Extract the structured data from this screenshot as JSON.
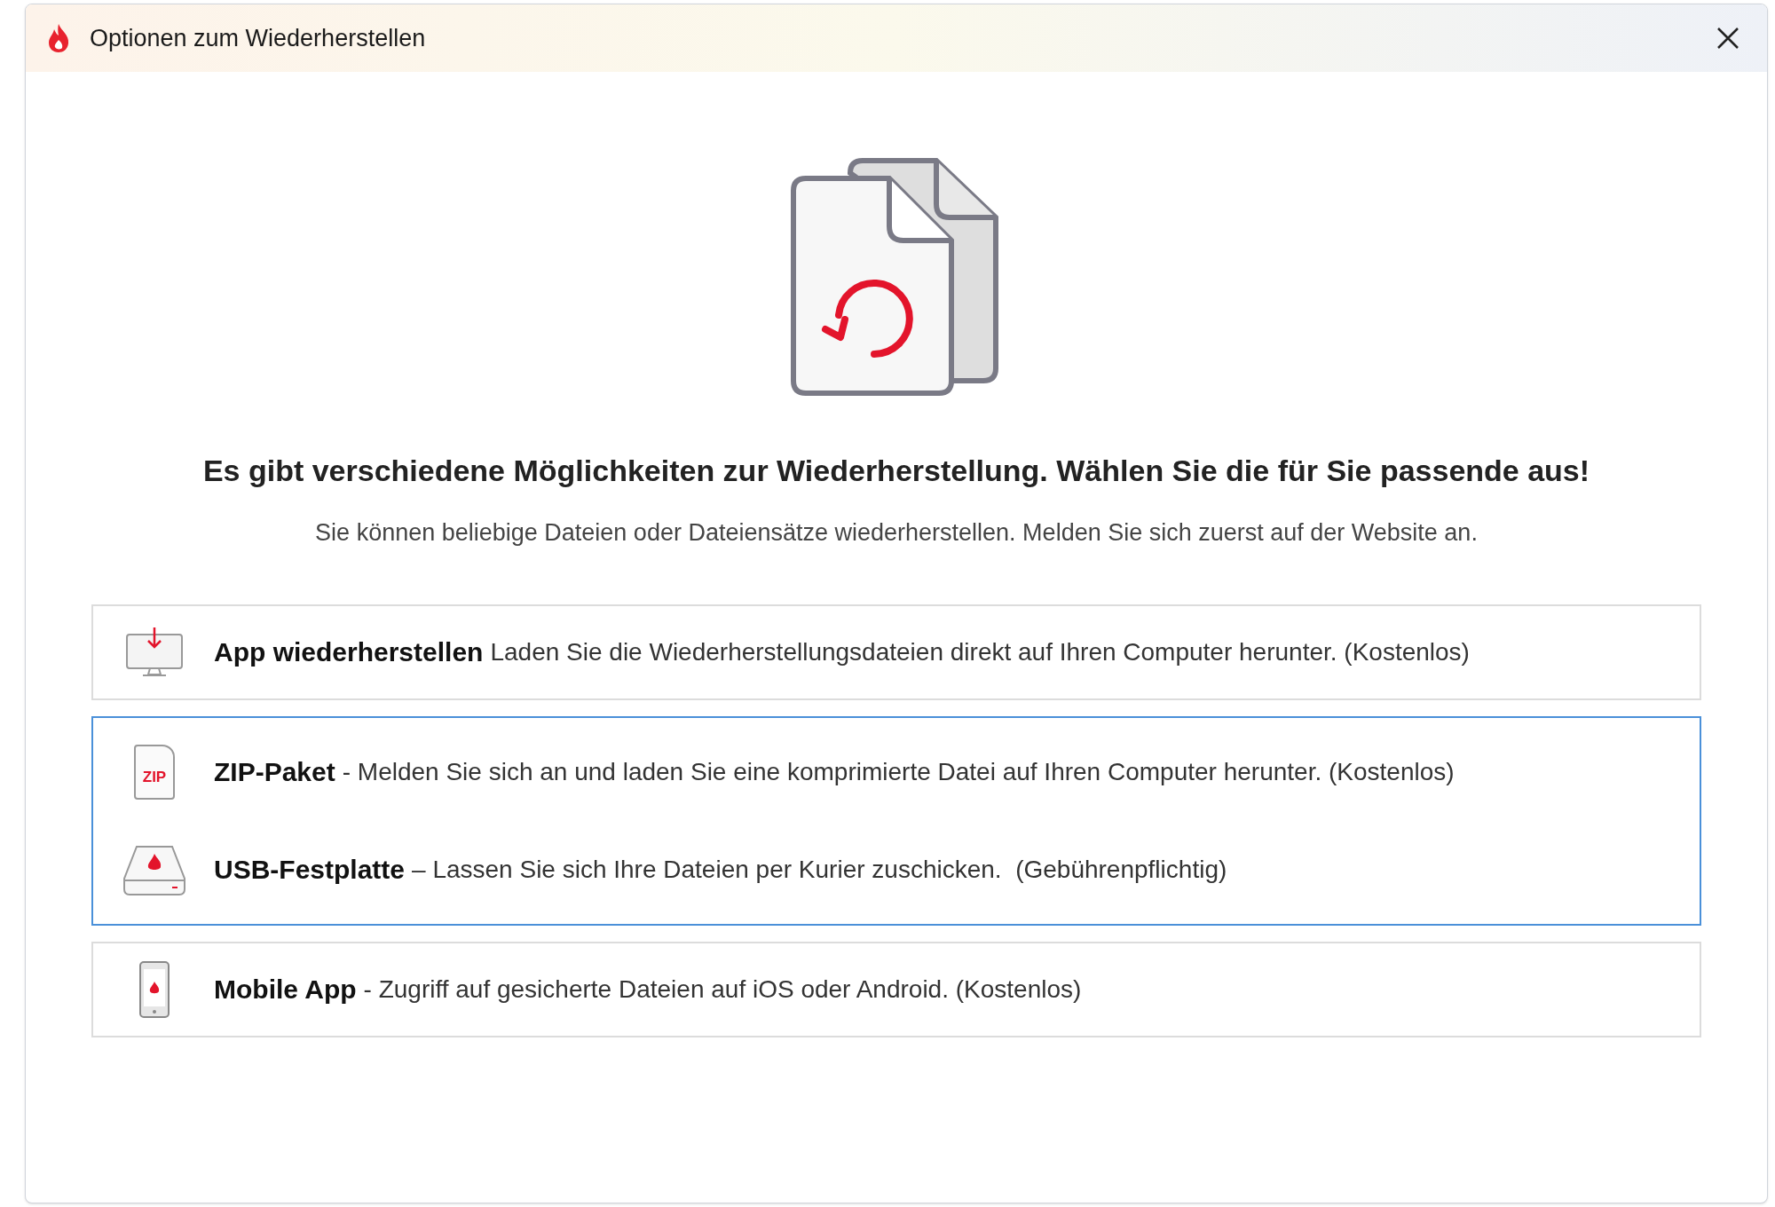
{
  "window": {
    "title": "Optionen zum Wiederherstellen"
  },
  "heading": "Es gibt verschiedene Möglichkeiten zur Wiederherstellung. Wählen Sie die für Sie passende aus!",
  "subtitle": "Sie können beliebige Dateien oder Dateiensätze wiederherstellen. Melden Sie sich zuerst auf der Website an.",
  "option_groups": [
    {
      "selected": false,
      "options": [
        {
          "kind": "monitor",
          "title": "App wiederherstellen",
          "description": "Laden Sie die Wiederherstellungsdateien direkt auf Ihren Computer herunter. (Kostenlos)"
        }
      ]
    },
    {
      "selected": true,
      "options": [
        {
          "kind": "zip",
          "icon_text": "ZIP",
          "title": "ZIP-Paket",
          "description": "- Melden Sie sich an und laden Sie eine komprimierte Datei auf Ihren Computer herunter. (Kostenlos)"
        },
        {
          "kind": "drive",
          "title": "USB-Festplatte",
          "description": "– Lassen Sie sich Ihre Dateien per Kurier zuschicken.  (Gebührenpflichtig)"
        }
      ]
    },
    {
      "selected": false,
      "options": [
        {
          "kind": "phone",
          "title": "Mobile App",
          "description": "- Zugriff auf gesicherte Dateien auf iOS oder Android. (Kostenlos)"
        }
      ]
    }
  ]
}
